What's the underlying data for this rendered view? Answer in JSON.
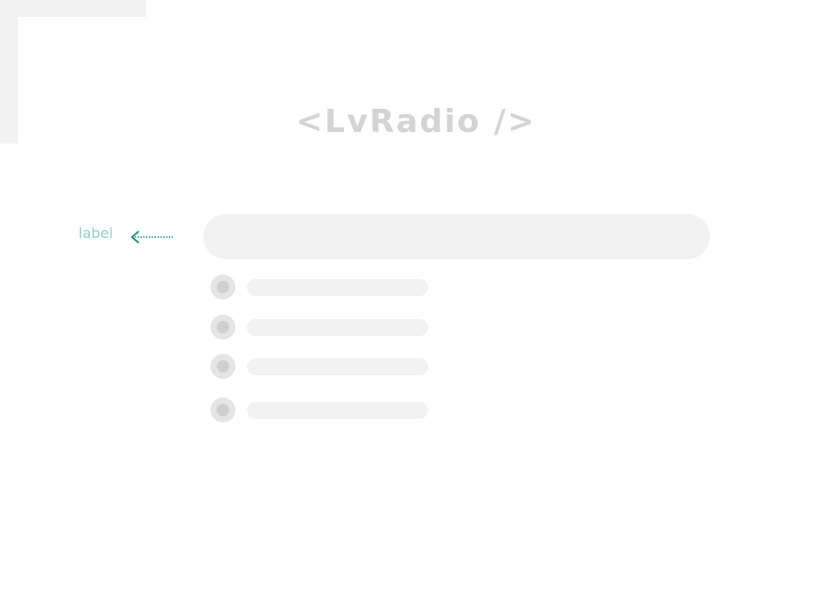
{
  "diagram": {
    "title": "<LvRadio />",
    "annotation": {
      "label": "label"
    },
    "colors": {
      "annotation": "#8fd0cc",
      "arrow": "#1f8f87",
      "placeholder": "#f2f2f2",
      "radio_outer": "#e5e5e5",
      "radio_inner": "#cfcfcf",
      "title": "#d4d4d4"
    },
    "radio_option_count": 4
  }
}
